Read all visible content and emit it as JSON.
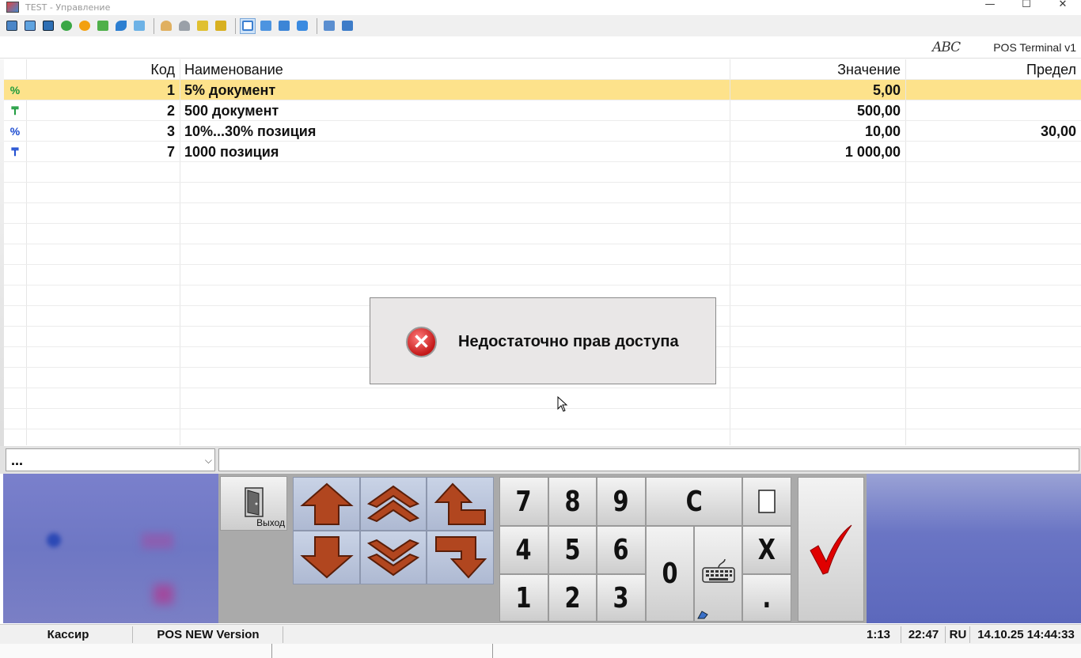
{
  "window": {
    "title": "TEST - Управление",
    "minimize": "—",
    "maximize": "☐",
    "close": "✕"
  },
  "header": {
    "logo": "ABC",
    "app_name": "POS Terminal v1"
  },
  "table": {
    "columns": {
      "kod": "Код",
      "name": "Наименование",
      "value": "Значение",
      "limit": "Предел"
    },
    "rows": [
      {
        "icon": "%",
        "kod": "1",
        "name": "5% документ",
        "value": "5,00",
        "limit": ""
      },
      {
        "icon": "₸",
        "kod": "2",
        "name": "500 документ",
        "value": "500,00",
        "limit": ""
      },
      {
        "icon": "%",
        "kod": "3",
        "name": "10%...30% позиция",
        "value": "10,00",
        "limit": "30,00"
      },
      {
        "icon": "₸",
        "kod": "7",
        "name": "1000 позиция",
        "value": "1 000,00",
        "limit": ""
      }
    ]
  },
  "dialog": {
    "message": "Недостаточно прав доступа"
  },
  "input": {
    "combo_value": "...",
    "combo_arrow": "⌵"
  },
  "keypad": {
    "exit_label": "Выход",
    "digits": [
      "7",
      "8",
      "9",
      "4",
      "5",
      "6",
      "1",
      "2",
      "3",
      "0"
    ],
    "clear": "C",
    "x": "X",
    "dot": "."
  },
  "status": {
    "role": "Кассир",
    "version": "POS NEW Version",
    "counter": "1:13",
    "time_short": "22:47",
    "lang": "RU",
    "datetime": "14.10.25  14:44:33"
  },
  "colors": {
    "selected_row": "#fde28b",
    "arrow_brown": "#b1461f",
    "check_red": "#e00000"
  }
}
